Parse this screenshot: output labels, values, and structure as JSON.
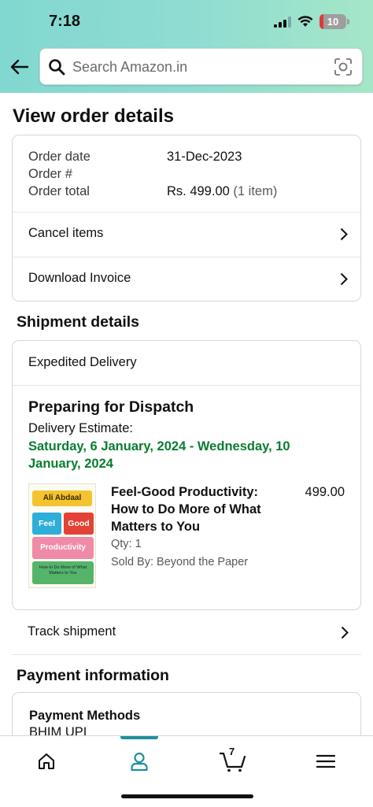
{
  "status_bar": {
    "time": "7:18",
    "battery": "10"
  },
  "header": {
    "search_placeholder": "Search Amazon.in"
  },
  "page_title": "View order details",
  "order_summary": {
    "rows": [
      {
        "label": "Order date",
        "value": "31-Dec-2023"
      },
      {
        "label": "Order #",
        "value": ""
      },
      {
        "label": "Order total",
        "value": "Rs. 499.00",
        "note": "(1 item)"
      }
    ],
    "actions": [
      {
        "label": "Cancel items"
      },
      {
        "label": "Download Invoice"
      }
    ]
  },
  "shipment": {
    "section_title": "Shipment details",
    "delivery_type": "Expedited Delivery",
    "status": "Preparing for Dispatch",
    "estimate_label": "Delivery Estimate:",
    "estimate_dates": "Saturday, 6 January, 2024 - Wednesday, 10 January, 2024",
    "item": {
      "title": "Feel-Good Productivity: How to Do More of What Matters to You",
      "price": "499.00",
      "qty": "Qty: 1",
      "seller": "Sold By: Beyond the Paper",
      "cover": {
        "author": "Ali Abdaal",
        "word1": "Feel",
        "word2": "Good",
        "word3": "Productivity",
        "subtitle": "How to Do More of What Matters to You"
      }
    },
    "track_label": "Track shipment"
  },
  "payment": {
    "section_title": "Payment information",
    "methods_title": "Payment Methods",
    "method": "BHIM UPI"
  },
  "tabbar": {
    "items": [
      {
        "icon": "home-icon"
      },
      {
        "icon": "user-icon",
        "active": true
      },
      {
        "icon": "cart-icon",
        "count": "7"
      },
      {
        "icon": "menu-icon"
      }
    ]
  },
  "colors": {
    "header_gradient_start": "#81d8d0",
    "header_gradient_end": "#a5e6c8",
    "delivery_green": "#067d2e",
    "accent_teal": "#1f8f9c"
  }
}
